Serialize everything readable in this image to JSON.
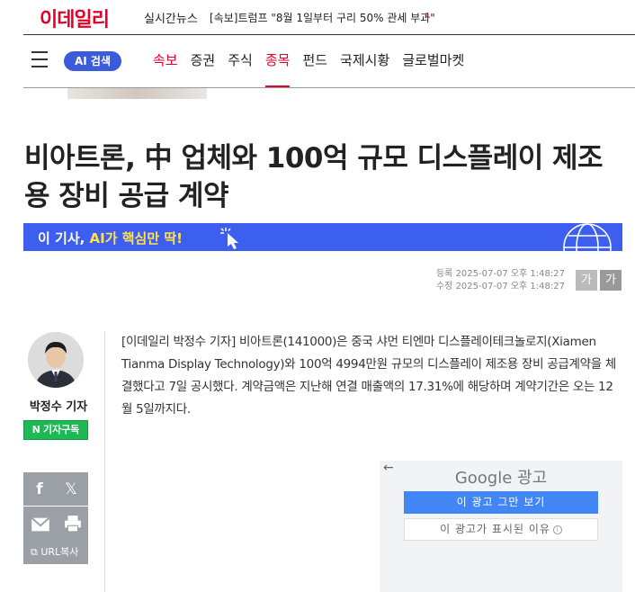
{
  "header": {
    "logo": "이데일리",
    "realtime_label": "실시간뉴스",
    "ticker": "[속보]트럼프 \"8월 1일부터 구리 50% 관세 부과\"",
    "ticker_arrow": "›"
  },
  "nav": {
    "ai_search": "AI 검색",
    "items": [
      {
        "label": "속보"
      },
      {
        "label": "증권"
      },
      {
        "label": "주식"
      },
      {
        "label": "종목"
      },
      {
        "label": "펀드"
      },
      {
        "label": "국제시황"
      },
      {
        "label": "글로벌마켓"
      }
    ],
    "active_item": "종목"
  },
  "article": {
    "headline": "비아트론, 中 업체와 100억 규모 디스플레이 제조용 장비 공급 계약",
    "ai_banner_prefix": "이 기사, ",
    "ai_banner_highlight": "AI가 핵심만 딱!",
    "registered": "등록 2025-07-07 오후 1:48:27",
    "modified": "수정 2025-07-07 오후 1:48:27",
    "font_small": "가",
    "font_large": "가",
    "body": "[이데일리 박정수 기자] 비아트론(141000)은 중국 샤먼 티엔마 디스플레이테크놀로지(Xiamen Tianma Display Technology)와 100억 4994만원 규모의 디스플레이 제조용 장비 공급계약을 체결했다고 7일 공시했다. 계약금액은 지난해 연결 매출액의 17.31%에 해당하며 계약기간은 오는 12월 5일까지다."
  },
  "author": {
    "name": "박정수 기자",
    "subscribe_n": "N",
    "subscribe_label": "기자구독"
  },
  "share": {
    "facebook": "f",
    "x": "𝕏",
    "url_copy": "URL복사"
  },
  "ad": {
    "back": "←",
    "title": "Google 광고",
    "stop_button": "이 광고 그만 보기",
    "why_button": "이 광고가 표시된 이유",
    "info": "i"
  },
  "colors": {
    "brand_red": "#e4002b",
    "ai_blue": "#3d5ff0",
    "subscribe_green": "#1db954",
    "google_blue": "#4285f4"
  }
}
